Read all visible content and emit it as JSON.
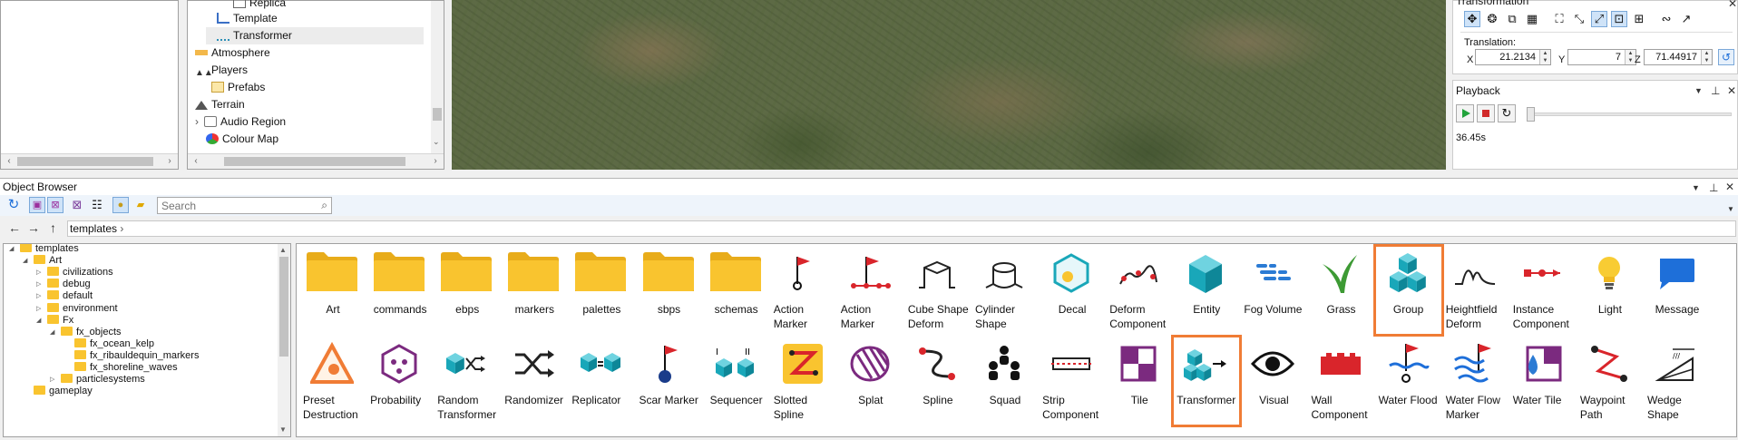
{
  "scene_tree": {
    "items": [
      "Replica",
      "Template",
      "Transformer",
      "Atmosphere",
      "Players",
      "Prefabs",
      "Terrain",
      "Audio Region",
      "Colour Map"
    ]
  },
  "transformation": {
    "title": "Transformation",
    "translation_label": "Translation:",
    "x_label": "X",
    "x": "21.2134",
    "y_label": "Y",
    "y": "7",
    "z_label": "Z",
    "z": "71.44917"
  },
  "playback": {
    "title": "Playback",
    "time": "36.45s"
  },
  "object_browser": {
    "title": "Object Browser",
    "search_placeholder": "Search",
    "breadcrumb": "templates",
    "tree": [
      "templates",
      "Art",
      "civilizations",
      "debug",
      "default",
      "environment",
      "Fx",
      "fx_objects",
      "fx_ocean_kelp",
      "fx_ribauldequin_markers",
      "fx_shoreline_waves",
      "particlesystems",
      "gameplay"
    ],
    "row1": [
      "Art",
      "commands",
      "ebps",
      "markers",
      "palettes",
      "sbps",
      "schemas",
      "Action Marker",
      "Action Marker",
      "Cube Shape Deform",
      "Cylinder Shape",
      "Decal",
      "Deform Component",
      "Entity",
      "Fog Volume",
      "Grass",
      "Group",
      "Heightfield Deform",
      "Instance Component",
      "Light",
      "Message"
    ],
    "row2": [
      "Preset Destruction",
      "Probability",
      "Random Transformer",
      "Randomizer",
      "Replicator",
      "Scar Marker",
      "Sequencer",
      "Slotted Spline",
      "Splat",
      "Spline",
      "Squad",
      "Strip Component",
      "Tile",
      "Transformer",
      "Visual",
      "Wall Component",
      "Water Flood",
      "Water Flow Marker",
      "Water Tile",
      "Waypoint Path",
      "Wedge Shape"
    ]
  },
  "colors": {
    "folder": "#f9c42f",
    "red": "#d9252b",
    "teal": "#19a7b9",
    "purple": "#7b2a7f",
    "selection": "#f07c35",
    "accent": "#1e6fd9"
  }
}
